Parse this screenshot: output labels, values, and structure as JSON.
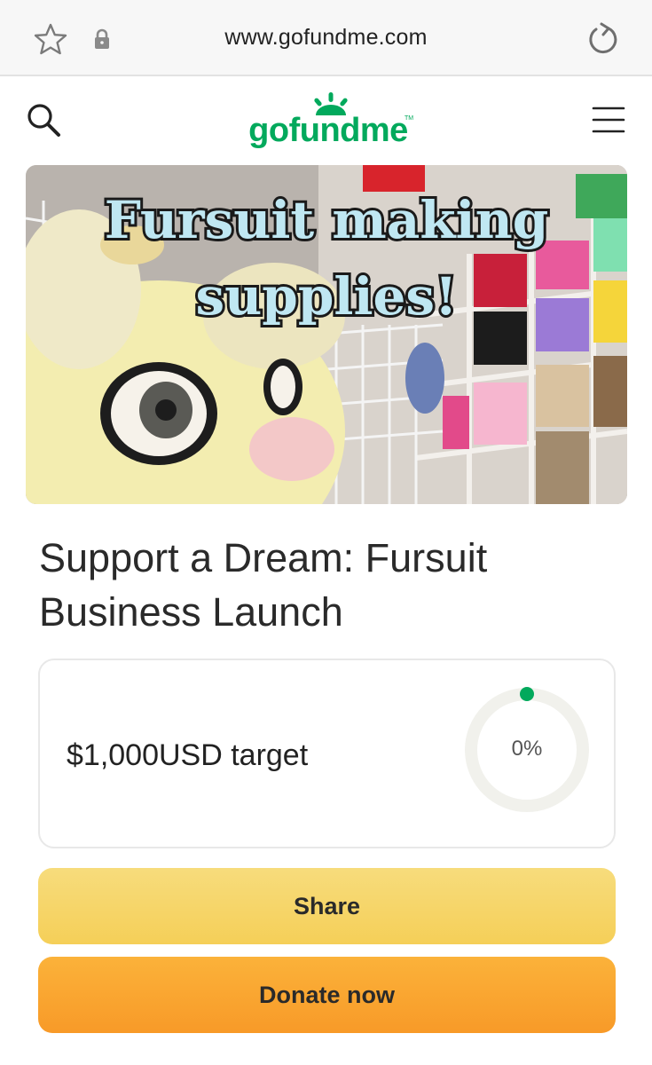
{
  "browser": {
    "url": "www.gofundme.com",
    "icons": [
      "star-icon",
      "lock-icon",
      "reload-icon"
    ]
  },
  "header": {
    "logo_text": "gofundme",
    "logo_tm": "TM",
    "icons": [
      "search-icon",
      "hamburger-menu-icon"
    ]
  },
  "hero": {
    "overlay_line1": "Fursuit making",
    "overlay_line2": "supplies!"
  },
  "campaign": {
    "title": "Support a Dream: Fursuit Business Launch",
    "goal_text": "$1,000USD target",
    "progress_label": "0%",
    "progress_fraction": 0
  },
  "actions": {
    "share_label": "Share",
    "donate_label": "Donate now"
  },
  "colors": {
    "brand_green": "#02a95c",
    "share_yellow": "#f6d366",
    "donate_orange": "#f9a630",
    "ring_track": "#f1f1ec"
  }
}
